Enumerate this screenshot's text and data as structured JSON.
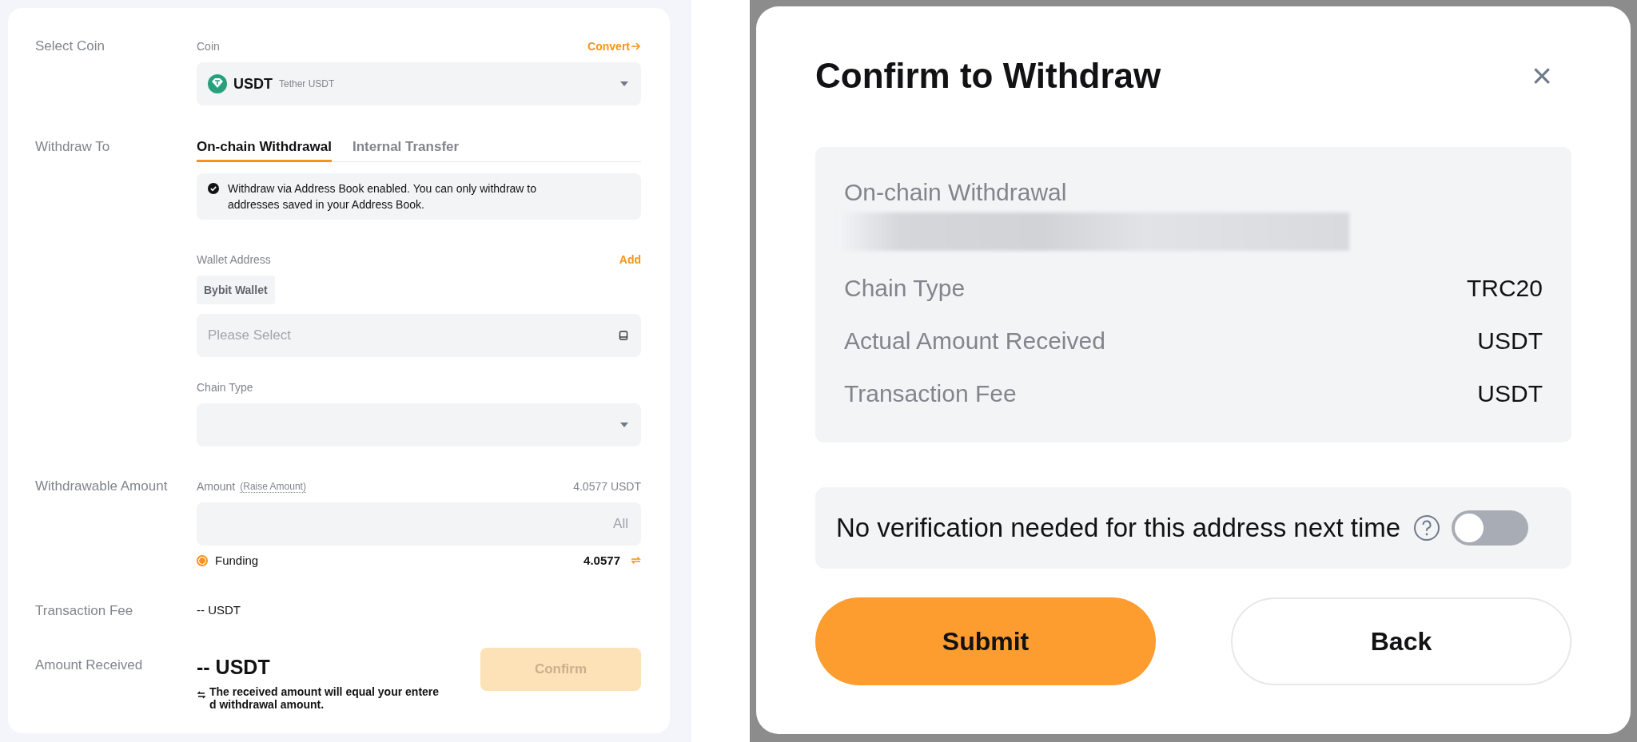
{
  "withdraw_form": {
    "select_coin": {
      "label": "Select Coin",
      "field_label": "Coin",
      "convert_link": "Convert",
      "coin": "USDT",
      "coin_name": "Tether USDT"
    },
    "withdraw_to": {
      "label": "Withdraw To",
      "tabs": [
        {
          "label": "On-chain Withdrawal",
          "selected": true
        },
        {
          "label": "Internal Transfer",
          "selected": false
        }
      ],
      "notice": "Withdraw via Address Book enabled. You can only withdraw to addresses saved in your Address Book.",
      "wallet_address_label": "Wallet Address",
      "add_link": "Add",
      "wallet_chip": "Bybit Wallet",
      "address_placeholder": "Please Select",
      "chain_type_label": "Chain Type"
    },
    "amount": {
      "label": "Withdrawable Amount",
      "field_label": "Amount",
      "raise_link": "(Raise Amount)",
      "available": "4.0577 USDT",
      "all_button": "All",
      "accounts": [
        {
          "name": "Funding",
          "balance": "4.0577",
          "selected": true
        }
      ]
    },
    "transaction_fee": {
      "label": "Transaction Fee",
      "value": "-- USDT"
    },
    "amount_received": {
      "label": "Amount Received",
      "value": "-- USDT",
      "note": "The received amount will equal your entere d withdrawal amount.",
      "confirm_button": "Confirm",
      "confirm_disabled": true
    }
  },
  "confirm_dialog": {
    "title": "Confirm to Withdraw",
    "close": "×",
    "summary": {
      "heading": "On-chain Withdrawal",
      "rows": [
        {
          "label": "Chain Type",
          "value": "TRC20"
        },
        {
          "label": "Actual Amount Received",
          "value": "USDT"
        },
        {
          "label": "Transaction Fee",
          "value": "USDT"
        }
      ]
    },
    "verification": {
      "label": "No verification needed for this address next time",
      "on": false
    },
    "buttons": [
      {
        "label": "Submit",
        "kind": "primary"
      },
      {
        "label": "Back",
        "kind": "secondary"
      }
    ]
  }
}
